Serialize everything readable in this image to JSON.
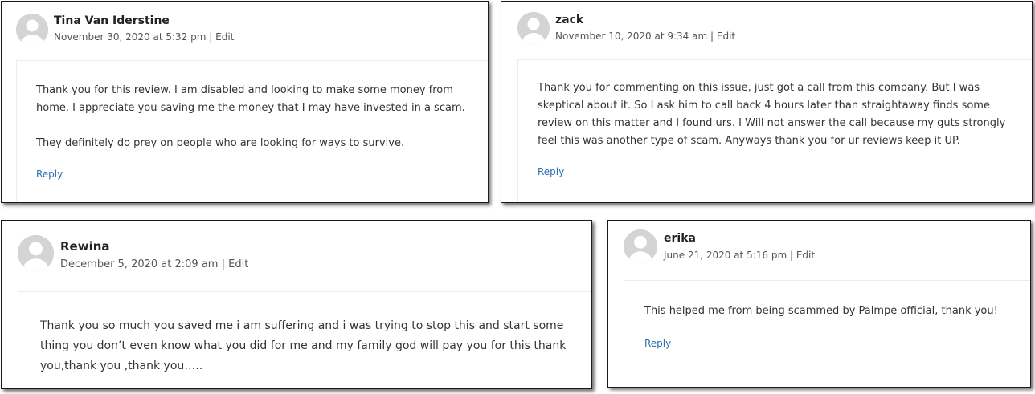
{
  "comments": [
    {
      "author": "Tina Van Iderstine",
      "date": "November 30, 2020 at 5:32 pm",
      "separator": "|",
      "edit": "Edit",
      "paragraphs": [
        "Thank you for this review. I am disabled and looking to make some money from home. I appreciate you saving me the money that I may have invested in a scam.",
        "They definitely do prey on people who are looking for ways to survive."
      ],
      "reply": "Reply"
    },
    {
      "author": "zack",
      "date": "November 10, 2020 at 9:34 am",
      "separator": "|",
      "edit": "Edit",
      "paragraphs": [
        "Thank you for commenting on this issue, just got a call from this company. But I was skeptical about it. So I ask him to call back 4 hours later than straightaway finds some review on this matter and I found urs. I Will not answer the call because my guts strongly feel this was another type of scam. Anyways thank you for ur reviews keep it UP."
      ],
      "reply": "Reply"
    },
    {
      "author": "Rewina",
      "date": "December 5, 2020 at 2:09 am",
      "separator": "|",
      "edit": "Edit",
      "paragraphs": [
        "Thank you so much you saved me i am suffering and i was trying to stop this and start some thing you don’t even know what you did for me and my family god will pay you for this thank you,thank you ,thank you….."
      ],
      "reply": ""
    },
    {
      "author": "erika",
      "date": "June 21, 2020 at 5:16 pm",
      "separator": "|",
      "edit": "Edit",
      "paragraphs": [
        "This helped me from being scammed by Palmpe official, thank you!"
      ],
      "reply": "Reply"
    }
  ],
  "colors": {
    "link": "#2a6fb0",
    "text": "#333333",
    "meta": "#555555",
    "avatar": "#d4d4d4"
  },
  "icons": {
    "avatar": "default-user-avatar-icon"
  }
}
